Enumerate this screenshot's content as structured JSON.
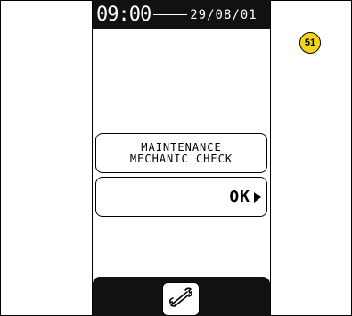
{
  "topbar": {
    "time": "09:00",
    "date": "29/08/01"
  },
  "message": {
    "line1": "MAINTENANCE",
    "line2": "MECHANIC CHECK"
  },
  "ok_button": {
    "label": "OK"
  },
  "badge": {
    "number": "51",
    "color": "#f2d51a"
  },
  "bottom_bar": {
    "button_icon": "wrench-icon"
  }
}
